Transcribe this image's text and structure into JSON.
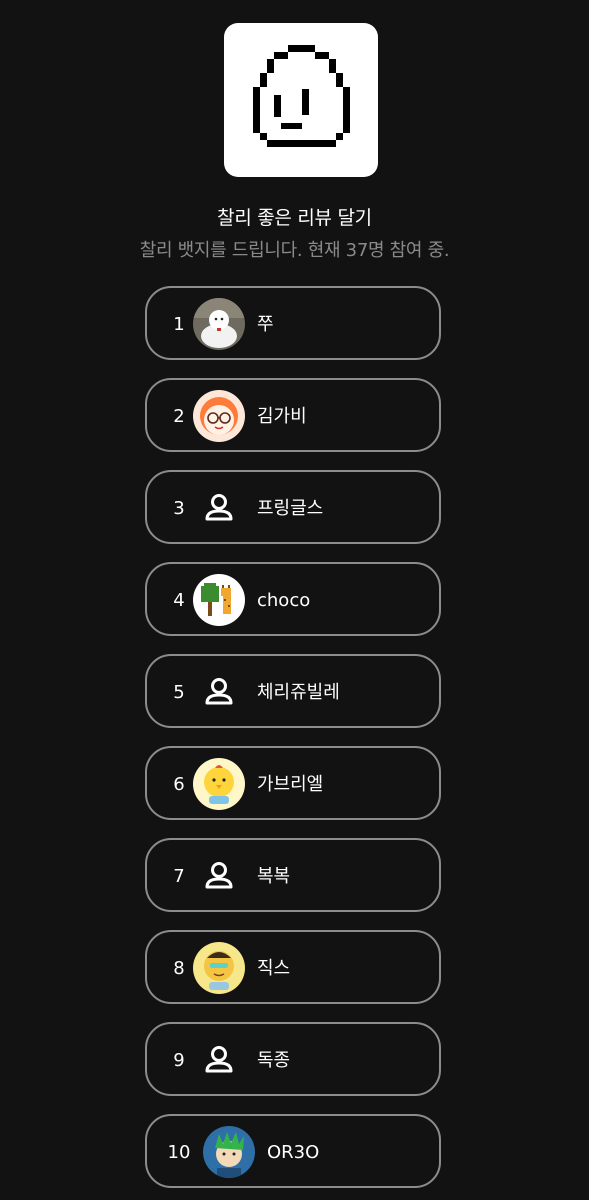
{
  "badge": {
    "icon": "pixel-face-icon",
    "title": "찰리 좋은 리뷰 달기",
    "subtitle": "찰리 뱃지를 드립니다. 현재 37명 참여 중."
  },
  "participants": [
    {
      "rank": "1",
      "name": "쭈",
      "avatar": "snowman-photo"
    },
    {
      "rank": "2",
      "name": "김가비",
      "avatar": "glasses-face"
    },
    {
      "rank": "3",
      "name": "프링글스",
      "avatar": "default-user-icon"
    },
    {
      "rank": "4",
      "name": "choco",
      "avatar": "pixel-tree-giraffe"
    },
    {
      "rank": "5",
      "name": "체리쥬빌레",
      "avatar": "default-user-icon"
    },
    {
      "rank": "6",
      "name": "가브리엘",
      "avatar": "yellow-chick"
    },
    {
      "rank": "7",
      "name": "복복",
      "avatar": "default-user-icon"
    },
    {
      "rank": "8",
      "name": "직스",
      "avatar": "yellow-character"
    },
    {
      "rank": "9",
      "name": "독종",
      "avatar": "default-user-icon"
    },
    {
      "rank": "10",
      "name": "OR3O",
      "avatar": "green-hair-character"
    }
  ],
  "colors": {
    "background": "#121212",
    "row_border": "#8c8c8c",
    "subtitle": "#8a8a8a"
  }
}
